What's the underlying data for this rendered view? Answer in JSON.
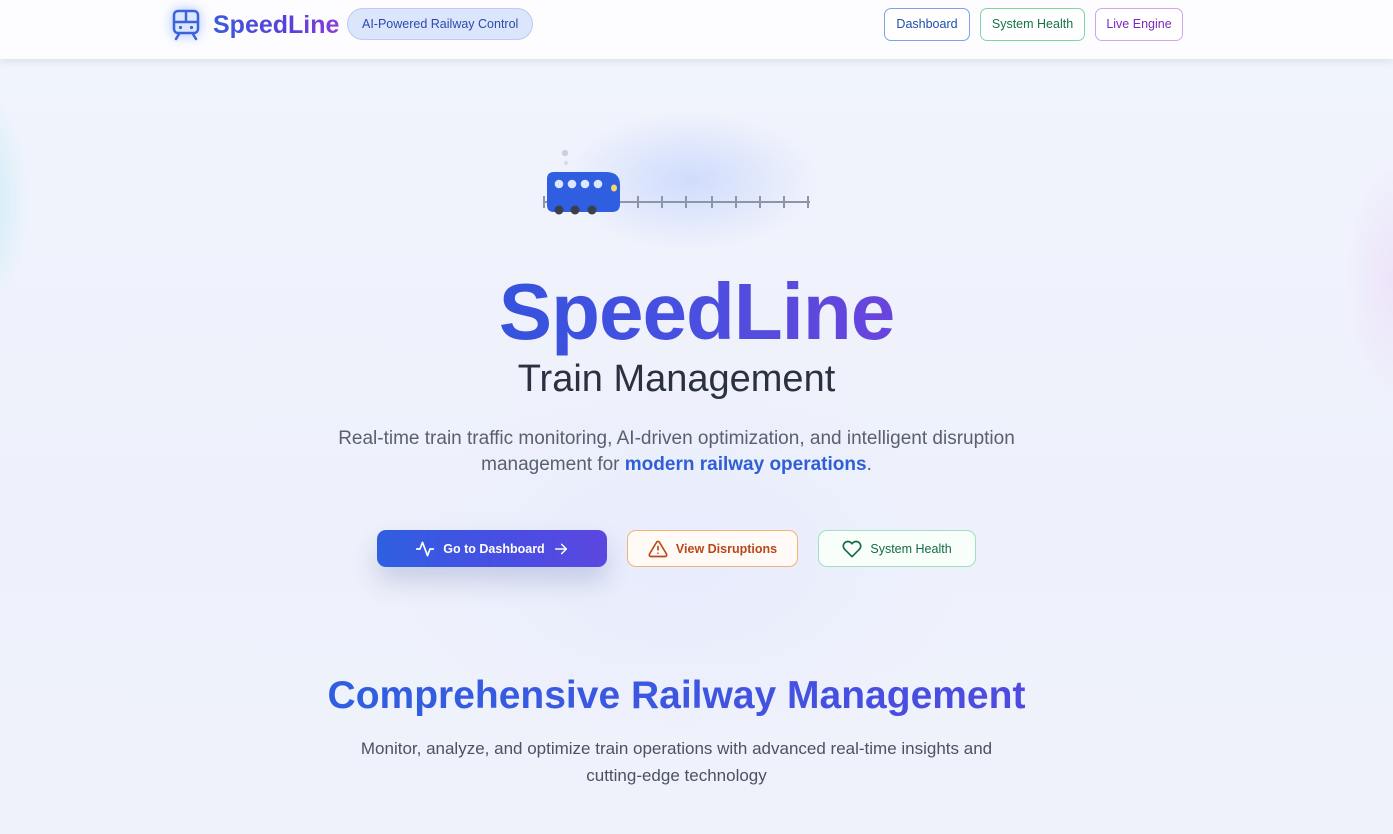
{
  "header": {
    "brand_name": "SpeedLine",
    "badge": "AI-Powered Railway Control",
    "nav": {
      "dashboard": "Dashboard",
      "system_health": "System Health",
      "live_engine": "Live Engine"
    }
  },
  "hero": {
    "title": "SpeedLine",
    "subtitle": "Train Management",
    "description_part1": "Real-time train traffic monitoring, AI-driven optimization, and intelligent disruption management for ",
    "description_highlight": "modern railway operations",
    "description_end": ".",
    "buttons": {
      "dashboard": "Go to Dashboard",
      "disruptions": "View Disruptions",
      "system_health": "System Health"
    }
  },
  "section": {
    "title": "Comprehensive Railway Management",
    "description": "Monitor, analyze, and optimize train operations with advanced real-time insights and cutting-edge technology"
  },
  "icons": {
    "brand": "train-icon",
    "activity": "activity-icon",
    "arrow": "arrow-right-icon",
    "warning": "alert-triangle-icon",
    "heart": "heart-icon"
  },
  "colors": {
    "primary": "#3553de",
    "accent_purple": "#6a44dd",
    "warning": "#b8481a",
    "success": "#146b43"
  }
}
